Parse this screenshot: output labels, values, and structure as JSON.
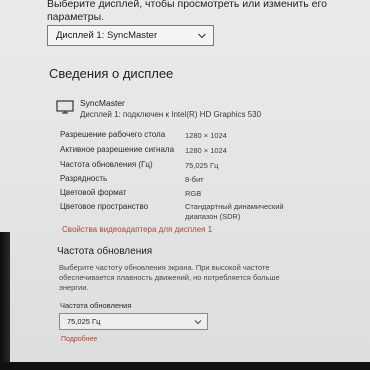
{
  "header": {
    "instruction_line1": "Выберите дисплей, чтобы просмотреть или изменить его",
    "instruction_line2": "параметры."
  },
  "display_select": {
    "selected": "Дисплей 1: SyncMaster",
    "icon": "chevron-down-icon"
  },
  "display_info": {
    "title": "Сведения о дисплее",
    "monitor_name": "SyncMaster",
    "monitor_subtitle": "Дисплей 1: подключен к Intel(R) HD Graphics 530",
    "icon": "monitor-icon",
    "properties": [
      {
        "label": "Разрешение рабочего стола",
        "value": "1280 × 1024"
      },
      {
        "label": "Активное разрешение сигнала",
        "value": "1280 × 1024"
      },
      {
        "label": "Частота обновления (Гц)",
        "value": "75,025 Гц"
      },
      {
        "label": "Разрядность",
        "value": "8-бит"
      },
      {
        "label": "Цветовой формат",
        "value": "RGB"
      },
      {
        "label": "Цветовое пространство",
        "value_line1": "Стандартный динамический",
        "value_line2": "диапазон (SDR)"
      }
    ],
    "adapter_link": "Свойства видеоадаптера для дисплея 1"
  },
  "refresh_rate": {
    "title": "Частота обновления",
    "description_line1": "Выберите частоту обновления экрана. При высокой частоте",
    "description_line2": "обеспечивается плавность движений, но потребляется больше",
    "description_line3": "энергии.",
    "select_label": "Частота обновления",
    "selected": "75,025 Гц",
    "more_link": "Подробнее"
  },
  "colors": {
    "link": "#b5432a",
    "background": "#e6e7e7"
  }
}
